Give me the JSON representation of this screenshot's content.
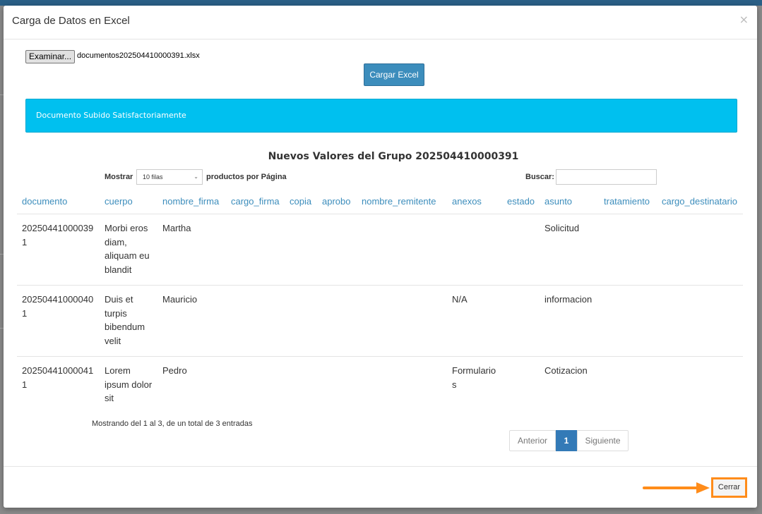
{
  "dialog": {
    "title": "Carga de Datos en Excel",
    "close_glyph": "×"
  },
  "upload": {
    "browse_label": "Examinar...",
    "file_name": "documentos202504410000391.xlsx",
    "submit_label": "Cargar Excel"
  },
  "alert": {
    "message": "Documento Subido Satisfactoriamente",
    "color": "#00c0ef"
  },
  "table_section": {
    "title": "Nuevos Valores del Grupo 202504410000391",
    "length_label": "Mostrar",
    "length_value": "10 filas",
    "length_suffix": "productos por Página",
    "search_label": "Buscar:",
    "search_value": "",
    "columns": [
      "documento",
      "cuerpo",
      "nombre_firma",
      "cargo_firma",
      "copia",
      "aprobo",
      "nombre_remitente",
      "anexos",
      "estado",
      "asunto",
      "tratamiento",
      "cargo_destinatario"
    ],
    "rows": [
      [
        "202504410000391",
        "Morbi eros diam, aliquam eu blandit",
        "Martha",
        "",
        "",
        "",
        "",
        "",
        "",
        "Solicitud",
        "",
        ""
      ],
      [
        "202504410000401",
        "Duis et turpis bibendum velit",
        "Mauricio",
        "",
        "",
        "",
        "",
        "N/A",
        "",
        "informacion",
        "",
        ""
      ],
      [
        "202504410000411",
        "Lorem ipsum dolor sit",
        "Pedro",
        "",
        "",
        "",
        "",
        "Formularios",
        "",
        "Cotizacion",
        "",
        ""
      ]
    ],
    "info": "Mostrando del 1 al 3, de un total de 3 entradas",
    "pagination": {
      "previous": "Anterior",
      "current": "1",
      "next": "Siguiente"
    }
  },
  "footer": {
    "close_label": "Cerrar"
  },
  "colors": {
    "header_link": "#3c8dbc",
    "primary_button": "#3c8dbc",
    "highlight": "#ff8c1a"
  },
  "icons": {
    "dialog_close": "close-icon",
    "select_caret": "chevron-down-icon",
    "annotation": "arrow-right-icon"
  }
}
